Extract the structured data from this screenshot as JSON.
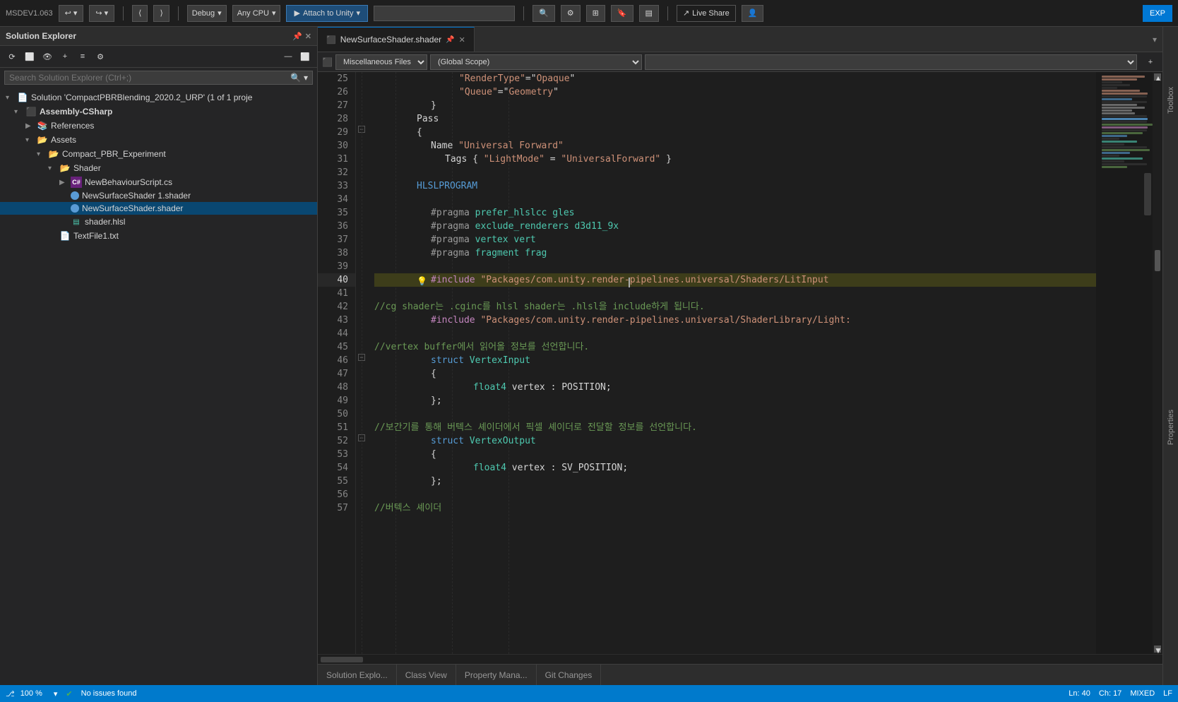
{
  "titlebar": {
    "logo": "MSDEV1.063",
    "debug_label": "Debug",
    "cpu_label": "Any CPU",
    "attach_label": "Attach to Unity",
    "live_share_label": "Live Share",
    "exp_label": "EXP"
  },
  "solution_explorer": {
    "title": "Solution Explorer",
    "search_placeholder": "Search Solution Explorer (Ctrl+;)",
    "solution_label": "Solution 'CompactPBRBlending_2020.2_URP' (1 of 1 proje",
    "assembly_label": "Assembly-CSharp",
    "references_label": "References",
    "assets_label": "Assets",
    "compact_pbr_label": "Compact_PBR_Experiment",
    "shader_label": "Shader",
    "new_behaviour_label": "NewBehaviourScript.cs",
    "new_surface_shader1_label": "NewSurfaceShader 1.shader",
    "new_surface_shader_label": "NewSurfaceShader.shader",
    "shader_hlsl_label": "shader.hlsl",
    "text_file_label": "TextFile1.txt"
  },
  "editor": {
    "tab_label": "NewSurfaceShader.shader",
    "misc_files_label": "Miscellaneous Files",
    "global_scope_label": "(Global Scope)"
  },
  "code_lines": [
    {
      "num": 25,
      "content": "\"RenderType\"=\"Opaque\"",
      "type": "string_only",
      "indent": 5
    },
    {
      "num": 26,
      "content": "\"Queue\"=\"Geometry\"",
      "type": "string_only",
      "indent": 5
    },
    {
      "num": 27,
      "content": "}",
      "type": "plain",
      "indent": 3
    },
    {
      "num": 28,
      "content": "Pass",
      "type": "plain",
      "indent": 2
    },
    {
      "num": 29,
      "content": "{",
      "type": "plain",
      "indent": 2,
      "fold": true
    },
    {
      "num": 30,
      "content": "Name \"Universal Forward\"",
      "type": "name_str",
      "indent": 3
    },
    {
      "num": 31,
      "content": "Tags { \"LightMode\" = \"UniversalForward\" }",
      "type": "tags",
      "indent": 4
    },
    {
      "num": 32,
      "content": "",
      "type": "empty"
    },
    {
      "num": 33,
      "content": "HLSLPROGRAM",
      "type": "keyword_plain",
      "indent": 2
    },
    {
      "num": 34,
      "content": "",
      "type": "empty"
    },
    {
      "num": 35,
      "content": "#pragma prefer_hlslcc gles",
      "type": "pragma",
      "indent": 3
    },
    {
      "num": 36,
      "content": "#pragma exclude_renderers d3d11_9x",
      "type": "pragma",
      "indent": 3
    },
    {
      "num": 37,
      "content": "#pragma vertex vert",
      "type": "pragma",
      "indent": 3
    },
    {
      "num": 38,
      "content": "#pragma fragment frag",
      "type": "pragma",
      "indent": 3
    },
    {
      "num": 39,
      "content": "",
      "type": "empty"
    },
    {
      "num": 40,
      "content": "#include \"Packages/com.unity.render-pipelines.universal/Shaders/LitInput",
      "type": "include",
      "indent": 3,
      "lightbulb": true,
      "active": true
    },
    {
      "num": 41,
      "content": "",
      "type": "empty"
    },
    {
      "num": 42,
      "content": "//cg shader는 .cginc를 hlsl shader는 .hlsl을 include하게 됩니다.",
      "type": "comment",
      "indent": 0
    },
    {
      "num": 43,
      "content": "#include \"Packages/com.unity.render-pipelines.universal/ShaderLibrary/Light:",
      "type": "include",
      "indent": 3
    },
    {
      "num": 44,
      "content": "",
      "type": "empty"
    },
    {
      "num": 45,
      "content": "//vertex buffer에서 읽어올 정보를 선언합니다.",
      "type": "comment",
      "indent": 0
    },
    {
      "num": 46,
      "content": "struct VertexInput",
      "type": "struct",
      "indent": 3,
      "fold": true
    },
    {
      "num": 47,
      "content": "{",
      "type": "plain",
      "indent": 3
    },
    {
      "num": 48,
      "content": "float4 vertex : POSITION;",
      "type": "member",
      "indent": 5
    },
    {
      "num": 49,
      "content": "};",
      "type": "plain",
      "indent": 3
    },
    {
      "num": 50,
      "content": "",
      "type": "empty"
    },
    {
      "num": 51,
      "content": "//보간기를 통해 버텍스 셰이더에서 픽셀 셰이더로 전달할 정보를 선언합니다.",
      "type": "comment",
      "indent": 0
    },
    {
      "num": 52,
      "content": "struct VertexOutput",
      "type": "struct",
      "indent": 3,
      "fold": true
    },
    {
      "num": 53,
      "content": "{",
      "type": "plain",
      "indent": 3
    },
    {
      "num": 54,
      "content": "float4 vertex   : SV_POSITION;",
      "type": "member",
      "indent": 5
    },
    {
      "num": 55,
      "content": "};",
      "type": "plain",
      "indent": 3
    },
    {
      "num": 56,
      "content": "",
      "type": "empty"
    },
    {
      "num": 57,
      "content": "//버텍스 셰이더",
      "type": "comment",
      "indent": 0
    }
  ],
  "statusbar": {
    "zoom_label": "100 %",
    "status_label": "No issues found",
    "ln_label": "Ln: 40",
    "ch_label": "Ch: 17",
    "encoding_label": "MIXED",
    "eol_label": "LF"
  },
  "bottom_tabs": [
    {
      "label": "Solution Explo...",
      "active": false
    },
    {
      "label": "Class View",
      "active": false
    },
    {
      "label": "Property Mana...",
      "active": false
    },
    {
      "label": "Git Changes",
      "active": false
    }
  ],
  "right_sidebar": [
    {
      "label": "Toolbox"
    },
    {
      "label": "Properties"
    }
  ]
}
